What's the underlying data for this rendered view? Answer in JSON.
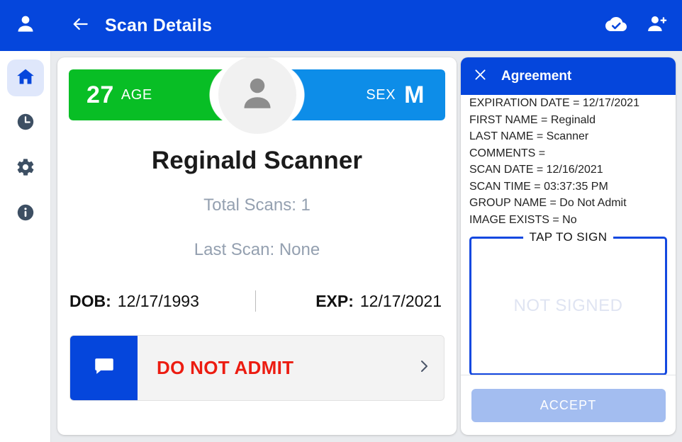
{
  "appbar": {
    "title": "Scan Details",
    "back_icon": "arrow-left-icon",
    "user_icon": "person-icon",
    "cloud_done_icon": "cloud-done-icon",
    "person_add_icon": "person-add-icon",
    "background_color": "#0546dc"
  },
  "sidebar": {
    "items": [
      {
        "name": "home",
        "icon": "home-icon",
        "active": true
      },
      {
        "name": "history",
        "icon": "clock-icon",
        "active": false
      },
      {
        "name": "settings",
        "icon": "gear-icon",
        "active": false
      },
      {
        "name": "info",
        "icon": "info-icon",
        "active": false
      }
    ],
    "active_bg": "#dfe7fb",
    "icon_color": "#3d4f63",
    "active_icon_color": "#0546dc"
  },
  "scan_card": {
    "age_badge": {
      "value": "27",
      "label": "AGE",
      "color": "#08be25"
    },
    "sex_badge": {
      "label": "SEX",
      "value": "M",
      "color": "#0d8de8"
    },
    "avatar_icon": "person-icon",
    "person_name": "Reginald Scanner",
    "total_scans": "Total Scans: 1",
    "last_scan": "Last Scan: None",
    "dob_key": "DOB:",
    "dob_value": "12/17/1993",
    "exp_key": "EXP:",
    "exp_value": "12/17/2021",
    "status": {
      "icon": "chat-bubble-icon",
      "label": "DO NOT ADMIT",
      "label_color": "#ec1c11",
      "chevron_icon": "chevron-right-icon"
    }
  },
  "agreement": {
    "close_icon": "close-icon",
    "title": "Agreement",
    "lines": [
      "EXPIRATION DATE = 12/17/2021",
      "FIRST NAME = Reginald",
      "LAST NAME = Scanner",
      "COMMENTS =",
      "SCAN DATE = 12/16/2021",
      "SCAN TIME = 03:37:35 PM",
      "GROUP NAME = Do Not Admit",
      "IMAGE EXISTS = No"
    ],
    "signature": {
      "legend": "TAP TO SIGN",
      "placeholder": "NOT SIGNED",
      "border_color": "#1348e0"
    },
    "accept_label": "ACCEPT",
    "accept_color": "#a3bdf0"
  }
}
